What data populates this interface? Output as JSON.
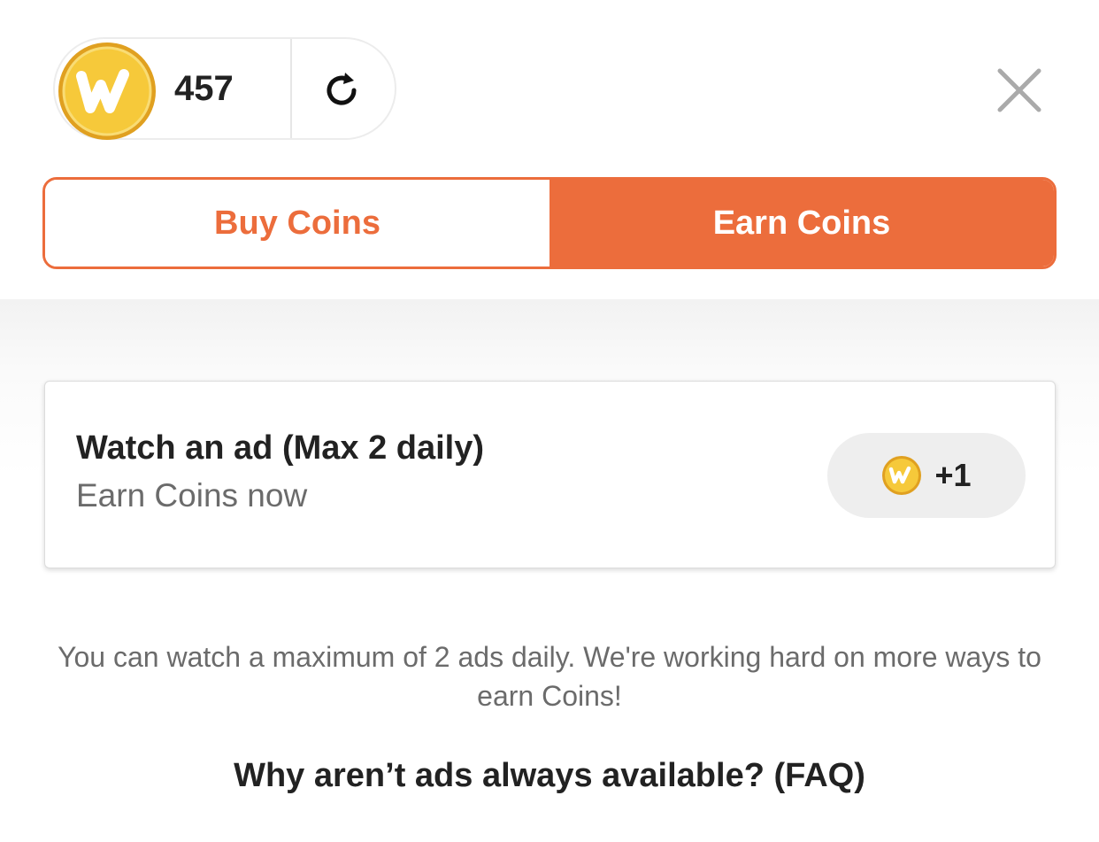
{
  "balance": {
    "coins": "457"
  },
  "tabs": [
    {
      "label": "Buy Coins",
      "active": false
    },
    {
      "label": "Earn Coins",
      "active": true
    }
  ],
  "ad_card": {
    "title": "Watch an ad (Max 2 daily)",
    "subtitle": "Earn Coins now",
    "reward": "+1"
  },
  "info_text": "You can watch a maximum of 2 ads daily. We're working hard on more ways to earn Coins!",
  "faq_link": "Why aren’t ads always available? (FAQ)",
  "colors": {
    "accent": "#ec6d3c",
    "coin": "#f4c530",
    "text_dark": "#222222",
    "text_muted": "#6b6b6b"
  }
}
